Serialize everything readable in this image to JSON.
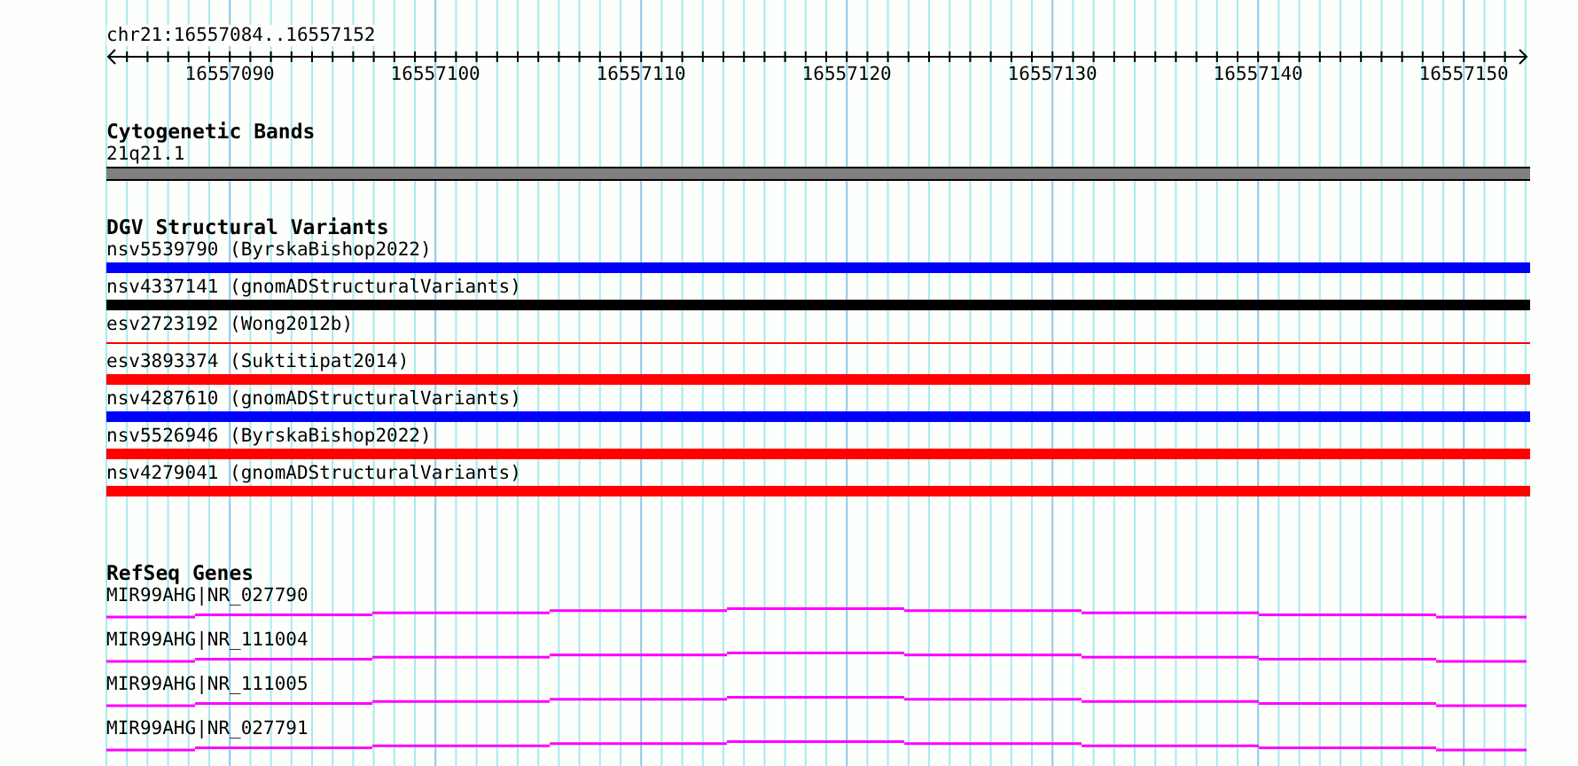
{
  "ruler": {
    "locus": "chr21:16557084..16557152",
    "tick_labels": [
      "16557090",
      "16557100",
      "16557110",
      "16557120",
      "16557130",
      "16557140",
      "16557150"
    ]
  },
  "tracks": [
    {
      "kind": "bands",
      "title": "Cytogenetic Bands",
      "features": [
        {
          "label": "21q21.1"
        }
      ]
    },
    {
      "kind": "variants",
      "title": "DGV Structural Variants",
      "features": [
        {
          "label": "nsv5539790 (ByrskaBishop2022)",
          "color": "#0000ff",
          "kind": "bar"
        },
        {
          "label": "nsv4337141 (gnomADStructuralVariants)",
          "color": "#000000",
          "kind": "bar"
        },
        {
          "label": "esv2723192 (Wong2012b)",
          "color": "#ff0000",
          "kind": "line"
        },
        {
          "label": "esv3893374 (Suktitipat2014)",
          "color": "#ff0000",
          "kind": "bar"
        },
        {
          "label": "nsv4287610 (gnomADStructuralVariants)",
          "color": "#0000ff",
          "kind": "bar"
        },
        {
          "label": "nsv5526946 (ByrskaBishop2022)",
          "color": "#ff0000",
          "kind": "bar"
        },
        {
          "label": "nsv4279041 (gnomADStructuralVariants)",
          "color": "#ff0000",
          "kind": "bar"
        }
      ]
    },
    {
      "kind": "genes",
      "title": "RefSeq Genes",
      "features": [
        {
          "label": "MIR99AHG|NR_027790"
        },
        {
          "label": "MIR99AHG|NR_111004"
        },
        {
          "label": "MIR99AHG|NR_111005"
        },
        {
          "label": "MIR99AHG|NR_027791"
        }
      ]
    }
  ]
}
